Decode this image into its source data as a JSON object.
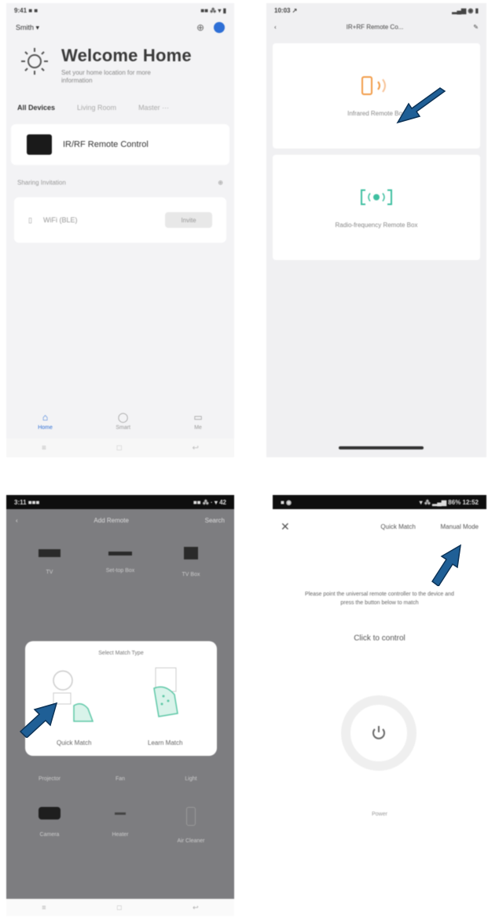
{
  "screen1": {
    "status": {
      "time": "9:41 ■ ■",
      "right": "■■ ⁂ ▾ ▮"
    },
    "home_name": "Smith ▾",
    "welcome_title": "Welcome Home",
    "welcome_sub": "Set your home location for more information",
    "tabs": [
      "All Devices",
      "Living Room",
      "Master ···"
    ],
    "device_name": "IR/RF Remote Control",
    "section": "Sharing Invitation",
    "hw_label": "WiFi (BLE)",
    "hw_btn": "Invite",
    "tabbar": [
      "Home",
      "Smart",
      "Me"
    ],
    "nav": [
      "≡",
      "□",
      "↩"
    ]
  },
  "screen2": {
    "status": {
      "time": "10:03 ↗",
      "right": "▂▄▆ ◉ ▮"
    },
    "title": "IR+RF Remote Co...",
    "option1": "Infrared Remote Box",
    "option2": "Radio-frequency Remote Box"
  },
  "screen3": {
    "status": {
      "time": "3:11 ■■■",
      "right": "■■ ⁂ · ▾ 42"
    },
    "title": "Add Remote",
    "right_label": "Search",
    "row1": [
      "TV",
      "Set-top Box",
      "TV Box"
    ],
    "dialog_title": "Select Match Type",
    "quick": "Quick Match",
    "learn": "Learn Match",
    "row2": [
      "Projector",
      "Fan",
      "Light"
    ],
    "row3": [
      "Camera",
      "Heater",
      "Air Cleaner"
    ],
    "nav": [
      "≡",
      "□",
      "↩"
    ]
  },
  "screen4": {
    "status": {
      "time": "■ ◉",
      "right": "▾ ⁂ ▂▄▆ 86% 12:52"
    },
    "close": "✕",
    "quick": "Quick Match",
    "manual": "Manual Mode",
    "instructions": "Please point the universal remote controller to the device and press the button below to match",
    "click": "Click to control",
    "power_label": "Power"
  },
  "colors": {
    "arrow": "#1f5f96",
    "accent": "#2e6fd6",
    "ir_orange": "#f29b47",
    "rf_green": "#3ebfa0"
  }
}
